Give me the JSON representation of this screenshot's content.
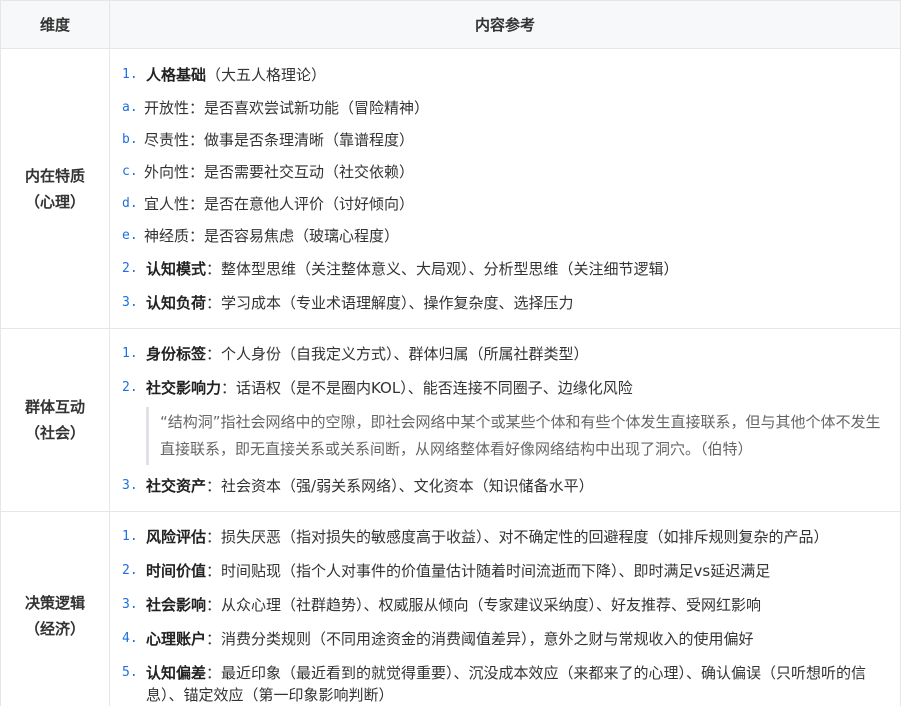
{
  "header": {
    "col1": "维度",
    "col2": "内容参考"
  },
  "sections": [
    {
      "dim_line1": "内在特质",
      "dim_line2": "（心理）",
      "items": [
        {
          "num": "1.",
          "label": "人格基础",
          "text": "（大五人格理论）",
          "subs": [
            {
              "num": "a.",
              "text": "开放性：是否喜欢尝试新功能（冒险精神）"
            },
            {
              "num": "b.",
              "text": "尽责性：做事是否条理清晰（靠谱程度）"
            },
            {
              "num": "c.",
              "text": "外向性：是否需要社交互动（社交依赖）"
            },
            {
              "num": "d.",
              "text": "宜人性：是否在意他人评价（讨好倾向）"
            },
            {
              "num": "e.",
              "text": "神经质：是否容易焦虑（玻璃心程度）"
            }
          ]
        },
        {
          "num": "2.",
          "label": "认知模式",
          "text": "：整体型思维（关注整体意义、大局观）、分析型思维（关注细节逻辑）"
        },
        {
          "num": "3.",
          "label": "认知负荷",
          "text": "：学习成本（专业术语理解度）、操作复杂度、选择压力"
        }
      ]
    },
    {
      "dim_line1": "群体互动",
      "dim_line2": "（社会）",
      "items": [
        {
          "num": "1.",
          "label": "身份标签",
          "text": "：个人身份（自我定义方式）、群体归属（所属社群类型）"
        },
        {
          "num": "2.",
          "label": "社交影响力",
          "text": "：话语权（是不是圈内KOL）、能否连接不同圈子、边缘化风险",
          "quote": "“结构洞”指社会网络中的空隙，即社会网络中某个或某些个体和有些个体发生直接联系，但与其他个体不发生直接联系，即无直接关系或关系间断，从网络整体看好像网络结构中出现了洞穴。（伯特）"
        },
        {
          "num": "3.",
          "label": "社交资产",
          "text": "：社会资本（强/弱关系网络）、文化资本（知识储备水平）"
        }
      ]
    },
    {
      "dim_line1": "决策逻辑",
      "dim_line2": "（经济）",
      "items": [
        {
          "num": "1.",
          "label": "风险评估",
          "text": "：损失厌恶（指对损失的敏感度高于收益）、对不确定性的回避程度（如排斥规则复杂的产品）"
        },
        {
          "num": "2.",
          "label": "时间价值",
          "text": "：时间贴现（指个人对事件的价值量估计随着时间流逝而下降）、即时满足vs延迟满足"
        },
        {
          "num": "3.",
          "label": "社会影响",
          "text": "：从众心理（社群趋势）、权威服从倾向（专家建议采纳度）、好友推荐、受网红影响"
        },
        {
          "num": "4.",
          "label": "心理账户",
          "text": "：消费分类规则（不同用途资金的消费阈值差异），意外之财与常规收入的使用偏好"
        },
        {
          "num": "5.",
          "label": "认知偏差",
          "text": "：最近印象（最近看到的就觉得重要）、沉没成本效应（来都来了的心理）、确认偏误（只听想听的信息）、锚定效应（第一印象影响判断）"
        }
      ]
    }
  ]
}
